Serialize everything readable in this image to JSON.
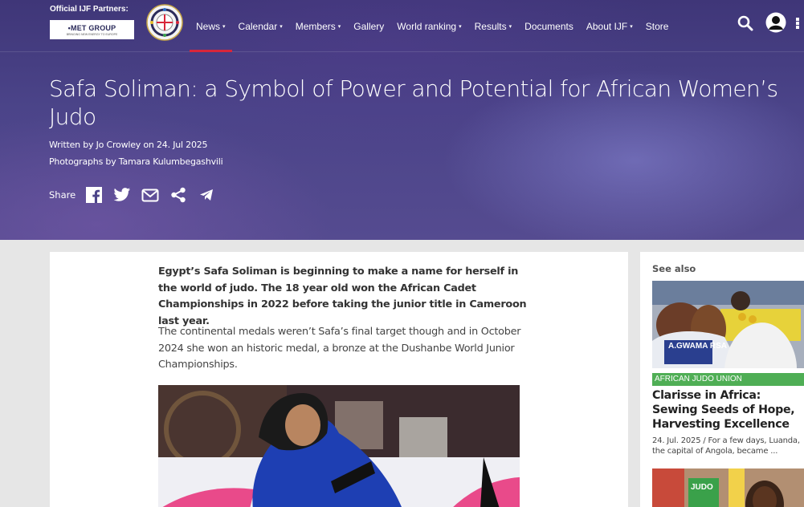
{
  "header": {
    "partners_label": "Official IJF Partners:",
    "partner_logo_text": "•MET GROUP",
    "partner_logo_sub": "BRINGING NEW ENERGY TO EUROPE",
    "nav": [
      {
        "label": "News",
        "caret": "▾",
        "active": true
      },
      {
        "label": "Calendar",
        "caret": "▾"
      },
      {
        "label": "Members",
        "caret": "▾"
      },
      {
        "label": "Gallery",
        "caret": ""
      },
      {
        "label": "World ranking",
        "caret": "▾"
      },
      {
        "label": "Results",
        "caret": "▾"
      },
      {
        "label": "Documents",
        "caret": ""
      },
      {
        "label": "About IJF",
        "caret": "▾"
      },
      {
        "label": "Store",
        "caret": ""
      }
    ],
    "accent_color": "#d8263a"
  },
  "hero": {
    "title": "Safa Soliman: a Symbol of Power and Potential for African Women’s Judo",
    "author_line": "Written by Jo Crowley on 24. Jul 2025",
    "photo_line": "Photographs by Tamara Kulumbegashvili",
    "share_label": "Share",
    "share_icons": [
      "facebook-icon",
      "twitter-icon",
      "email-icon",
      "share-icon",
      "telegram-icon"
    ]
  },
  "article": {
    "lead": "Egypt’s Safa Soliman is beginning to make a name for herself in the world of judo. The 18 year old won the African Cadet Championships in 2022 before taking the junior title in Cameroon last year.",
    "paragraph1": "The continental medals weren’t Safa’s final target though and in October 2024 she won an historic medal, a bronze at the Dushanbe World Junior Championships."
  },
  "sidebar": {
    "heading": "See also",
    "card": {
      "tag": "AFRICAN JUDO UNION",
      "tag_color": "#4fae55",
      "title": "Clarisse in Africa: Sewing Seeds of Hope, Harvesting Excellence",
      "meta": "24. Jul. 2025 / For a few days, Luanda, the capital of Angola, became ...",
      "photo_text": "A.GWAMA RSA"
    },
    "card2_photo_text": "JUDO"
  }
}
